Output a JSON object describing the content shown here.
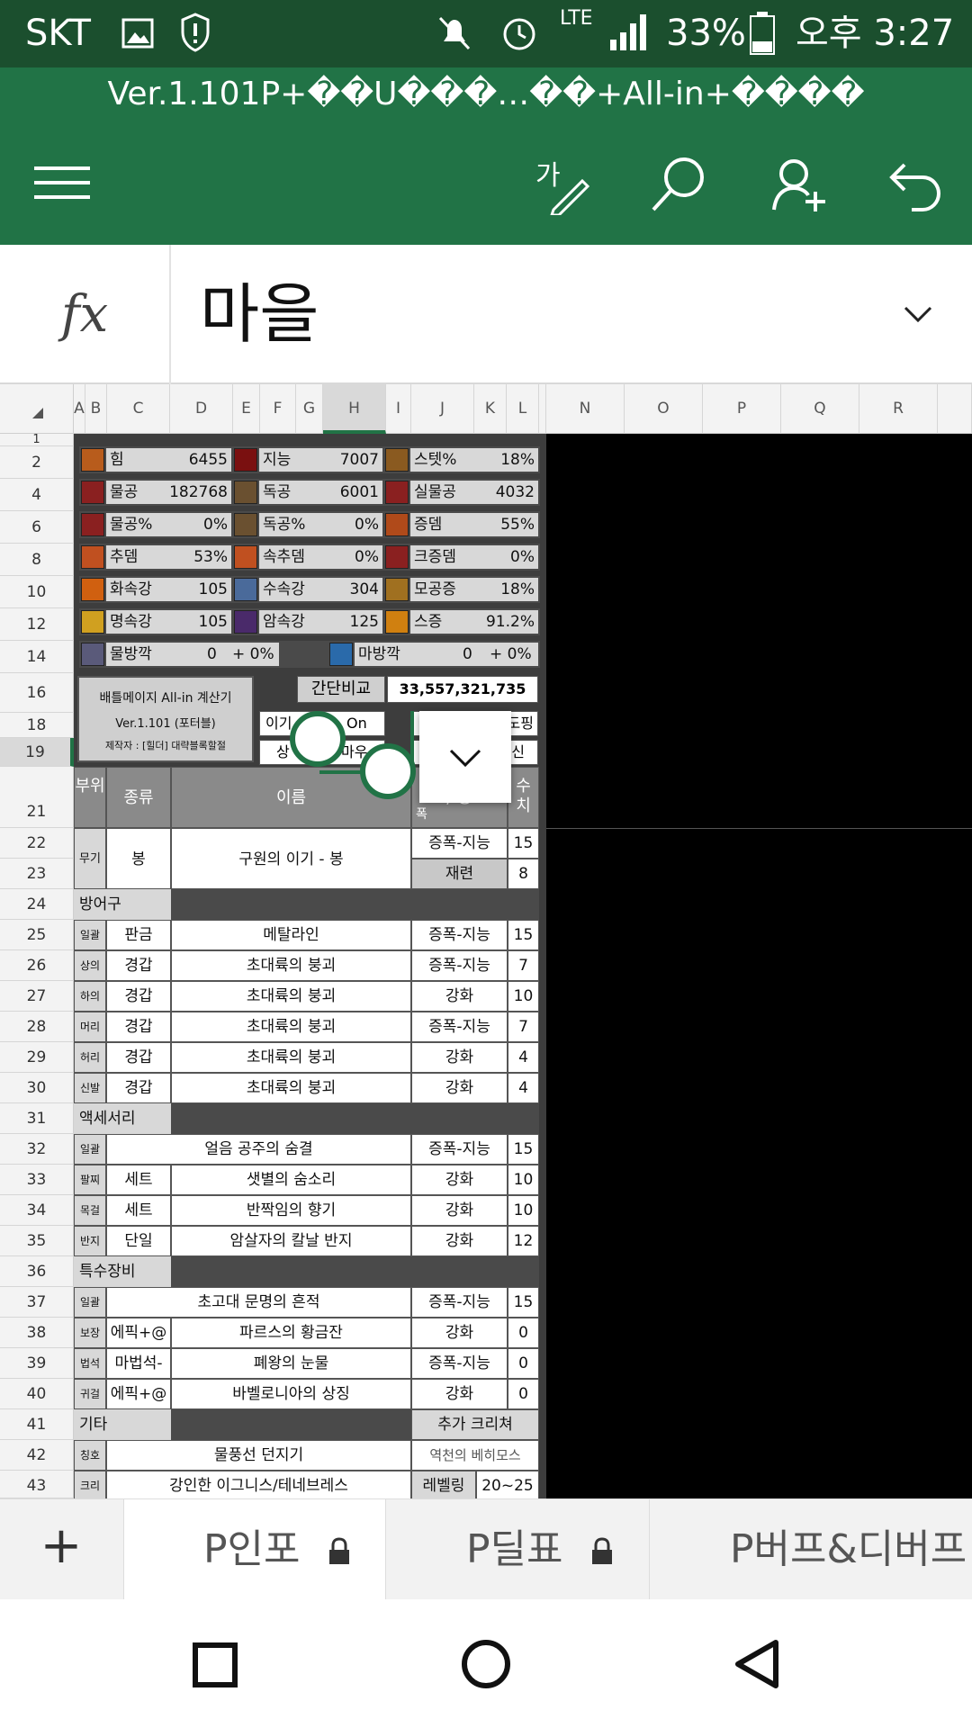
{
  "status": {
    "carrier": "SKT",
    "network": "LTE",
    "battery": "33%",
    "time": "오후 3:27"
  },
  "title": "Ver.1.101P+��U���…��+All-in+����",
  "toolbar": {
    "icons": [
      "menu-icon",
      "edit-pen-icon",
      "search-icon",
      "add-person-icon",
      "undo-icon"
    ]
  },
  "formula": {
    "fx": "fx",
    "value": "마을"
  },
  "columns": [
    "A",
    "B",
    "C",
    "D",
    "E",
    "F",
    "G",
    "H",
    "I",
    "J",
    "K",
    "L",
    "N",
    "O",
    "P",
    "Q",
    "R"
  ],
  "rows": [
    "1",
    "2",
    "4",
    "6",
    "8",
    "10",
    "12",
    "14",
    "16",
    "18",
    "19",
    "21",
    "22",
    "23",
    "24",
    "25",
    "26",
    "27",
    "28",
    "29",
    "30",
    "31",
    "32",
    "33",
    "34",
    "35",
    "36",
    "37",
    "38",
    "39",
    "40",
    "41",
    "42",
    "43"
  ],
  "stats": [
    [
      {
        "label": "힘",
        "value": "6455"
      },
      {
        "label": "지능",
        "value": "7007"
      },
      {
        "label": "스텟%",
        "value": "18%"
      }
    ],
    [
      {
        "label": "물공",
        "value": "182768"
      },
      {
        "label": "독공",
        "value": "6001"
      },
      {
        "label": "실물공",
        "value": "4032"
      }
    ],
    [
      {
        "label": "물공%",
        "value": "0%"
      },
      {
        "label": "독공%",
        "value": "0%"
      },
      {
        "label": "증뎀",
        "value": "55%"
      }
    ],
    [
      {
        "label": "추뎀",
        "value": "53%"
      },
      {
        "label": "속추뎀",
        "value": "0%"
      },
      {
        "label": "크증뎀",
        "value": "0%"
      }
    ],
    [
      {
        "label": "화속강",
        "value": "105"
      },
      {
        "label": "수속강",
        "value": "304"
      },
      {
        "label": "모공증",
        "value": "18%"
      }
    ],
    [
      {
        "label": "명속강",
        "value": "105"
      },
      {
        "label": "암속강",
        "value": "125"
      },
      {
        "label": "스증",
        "value": "91.2%"
      }
    ]
  ],
  "def_row": {
    "phys_label": "물방깍",
    "phys_value": "0",
    "phys_pct": "+ 0%",
    "mag_label": "마방깍",
    "mag_value": "0",
    "mag_pct": "+ 0%"
  },
  "calc_box": {
    "title": "배틀메이지 All-in 계산기",
    "version": "Ver.1.101 (포터블)",
    "author": "제작자 : [힐더] 대략블록할절"
  },
  "compare": {
    "label": "간단비교",
    "value": "33,557,321,735"
  },
  "partial": {
    "a": "이기",
    "b": "On",
    "c": "도핑",
    "d": "상",
    "e": "마우",
    "f": "신"
  },
  "table_header": {
    "part": "부위",
    "kind": "종류",
    "name": "이름",
    "opt": "/ 증",
    "num": "수치",
    "sub": "폭"
  },
  "weapon": {
    "part": "무기",
    "kind": "봉",
    "name": "구원의 이기 - 봉",
    "opt1": "증폭-지능",
    "val1": "15",
    "opt2": "재련",
    "val2": "8"
  },
  "armor_title": "방어구",
  "armor": [
    {
      "part": "일괄",
      "kind": "판금",
      "name": "메탈라인",
      "opt": "증폭-지능",
      "val": "15"
    },
    {
      "part": "상의",
      "kind": "경갑",
      "name": "초대륙의 붕괴",
      "opt": "증폭-지능",
      "val": "7"
    },
    {
      "part": "하의",
      "kind": "경갑",
      "name": "초대륙의 붕괴",
      "opt": "강화",
      "val": "10"
    },
    {
      "part": "머리",
      "kind": "경갑",
      "name": "초대륙의 붕괴",
      "opt": "증폭-지능",
      "val": "7"
    },
    {
      "part": "허리",
      "kind": "경갑",
      "name": "초대륙의 붕괴",
      "opt": "강화",
      "val": "4"
    },
    {
      "part": "신발",
      "kind": "경갑",
      "name": "초대륙의 붕괴",
      "opt": "강화",
      "val": "4"
    }
  ],
  "acc_title": "액세서리",
  "acc": [
    {
      "part": "일괄",
      "kind": "",
      "name": "얼음 공주의 숨결",
      "opt": "증폭-지능",
      "val": "15"
    },
    {
      "part": "팔찌",
      "kind": "세트",
      "name": "샛별의 숨소리",
      "opt": "강화",
      "val": "10"
    },
    {
      "part": "목걸",
      "kind": "세트",
      "name": "반짝임의 향기",
      "opt": "강화",
      "val": "10"
    },
    {
      "part": "반지",
      "kind": "단일",
      "name": "암살자의 칼날 반지",
      "opt": "강화",
      "val": "12"
    }
  ],
  "special_title": "특수장비",
  "special": [
    {
      "part": "일괄",
      "kind": "",
      "name": "초고대 문명의 흔적",
      "opt": "증폭-지능",
      "val": "15"
    },
    {
      "part": "보장",
      "kind": "에픽+@",
      "name": "파르스의 황금잔",
      "opt": "강화",
      "val": "0"
    },
    {
      "part": "법석",
      "kind": "마법석-",
      "name": "폐왕의 눈물",
      "opt": "증폭-지능",
      "val": "0"
    },
    {
      "part": "귀걸",
      "kind": "에픽+@",
      "name": "바벨로니아의 상징",
      "opt": "강화",
      "val": "0"
    }
  ],
  "etc": {
    "title": "기타",
    "extra": "추가 크리쳐",
    "title_part": "칭호",
    "title_name": "물풍선 던지기",
    "title_extra": "역천의 베히모스",
    "cr_part": "크리",
    "cr_name": "강인한 이그니스/테네브레스",
    "cr_opt": "레벨링",
    "cr_val": "20~25"
  },
  "tabs": {
    "add": "+",
    "tab1": "P인포",
    "tab2": "P딜표",
    "tab3": "P버프&디버프"
  }
}
